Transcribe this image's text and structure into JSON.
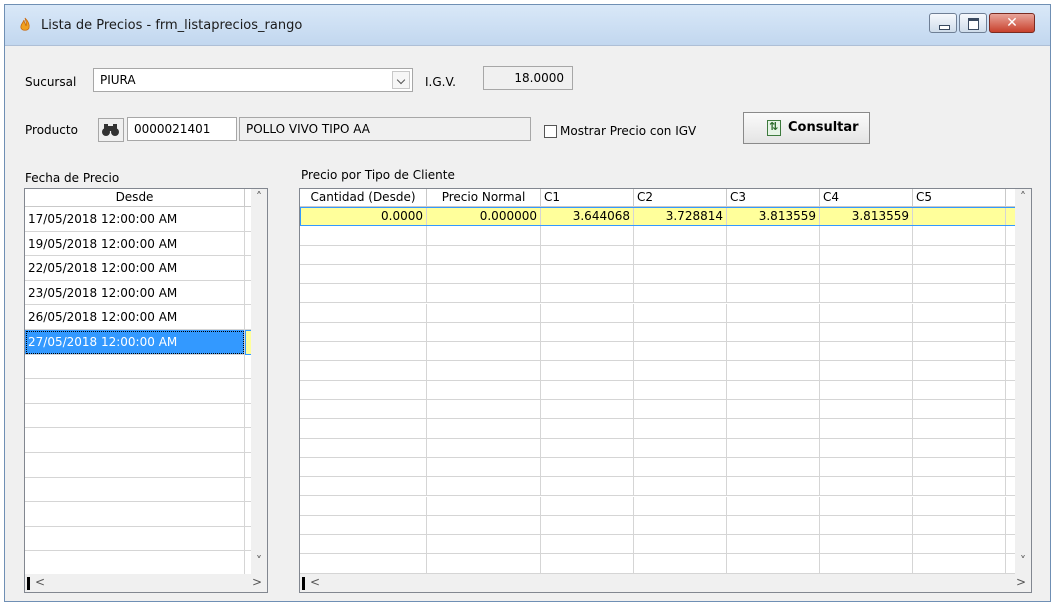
{
  "window": {
    "title": "Lista de Precios - frm_listaprecios_rango"
  },
  "form": {
    "sucursal_label": "Sucursal",
    "sucursal_value": "PIURA",
    "igv_label": "I.G.V.",
    "igv_value": "18.0000",
    "producto_label": "Producto",
    "producto_code": "0000021401",
    "producto_name": "POLLO VIVO TIPO AA",
    "mostrar_igv_label": "Mostrar Precio con IGV",
    "mostrar_igv_checked": false,
    "consultar_label": "Consultar"
  },
  "fechas": {
    "group_label": "Fecha de Precio",
    "column": "Desde",
    "rows": [
      "17/05/2018 12:00:00 AM",
      "19/05/2018 12:00:00 AM",
      "22/05/2018 12:00:00 AM",
      "23/05/2018 12:00:00 AM",
      "26/05/2018 12:00:00 AM",
      "27/05/2018 12:00:00 AM"
    ],
    "selected_index": 5
  },
  "precios": {
    "group_label": "Precio por Tipo de Cliente",
    "columns": [
      "Cantidad (Desde)",
      "Precio Normal",
      "C1",
      "C2",
      "C3",
      "C4",
      "C5"
    ],
    "rows": [
      [
        "0.0000",
        "0.000000",
        "3.644068",
        "3.728814",
        "3.813559",
        "3.813559",
        ""
      ]
    ]
  },
  "icons": {
    "app": "flame-icon",
    "find": "binoculars-icon",
    "consultar": "refresh-icon"
  },
  "colors": {
    "selection_blue": "#3399ff",
    "highlight_yellow": "#ffff9b"
  }
}
